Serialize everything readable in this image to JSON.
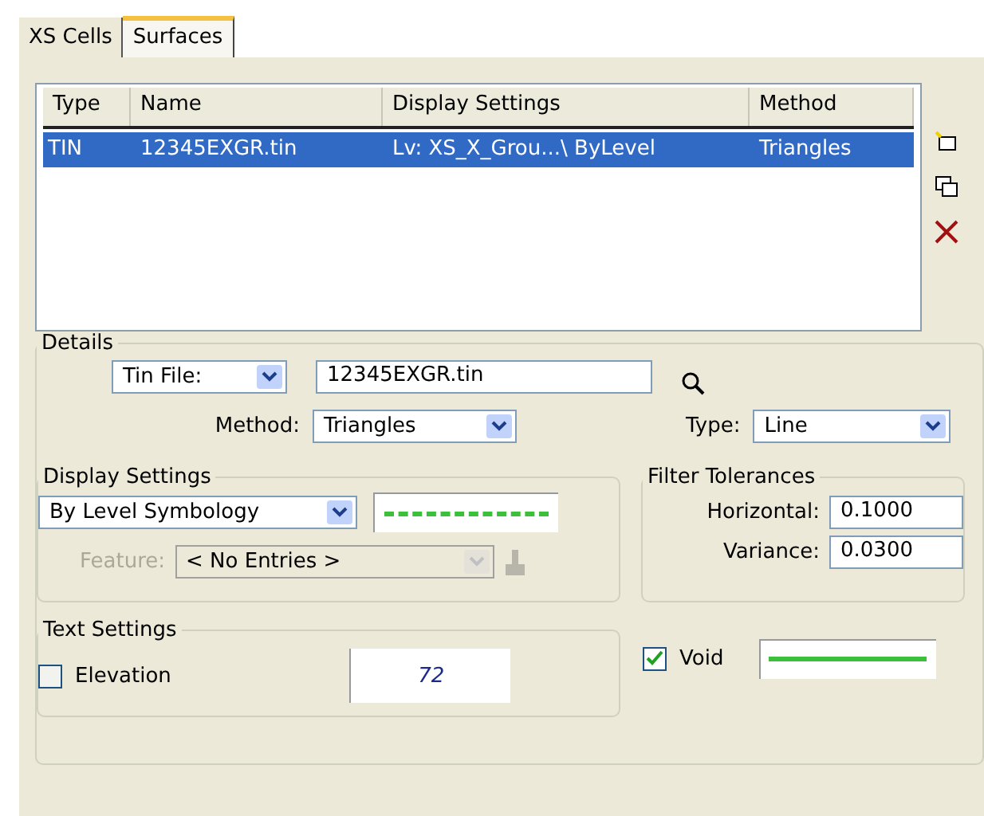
{
  "tabs": [
    {
      "label": "XS Cells",
      "selected": false
    },
    {
      "label": "Surfaces",
      "selected": true
    }
  ],
  "table": {
    "columns": [
      "Type",
      "Name",
      "Display Settings",
      "Method"
    ],
    "rows": [
      {
        "cells": [
          "TIN",
          "12345EXGR.tin",
          "Lv: XS_X_Grou...\\ ByLevel",
          "Triangles"
        ],
        "selected": true
      }
    ]
  },
  "details": {
    "title": "Details",
    "tin_file": {
      "label": "Tin File:",
      "value": "12345EXGR.tin"
    },
    "method": {
      "label": "Method:",
      "value": "Triangles"
    },
    "type": {
      "label": "Type:",
      "value": "Line"
    },
    "display_settings": {
      "title": "Display Settings",
      "symbology": "By Level Symbology",
      "feature": {
        "label": "Feature:",
        "value": "< No Entries >",
        "disabled": true
      }
    },
    "filter_tolerances": {
      "title": "Filter Tolerances",
      "fields": [
        {
          "label": "Horizontal:",
          "value": "0.1000"
        },
        {
          "label": "Variance:",
          "value": "0.0300"
        }
      ]
    },
    "text_settings": {
      "title": "Text Settings",
      "elevation": {
        "label": "Elevation",
        "checked": false
      },
      "preview": "72"
    },
    "void": {
      "label": "Void",
      "checked": true
    }
  }
}
